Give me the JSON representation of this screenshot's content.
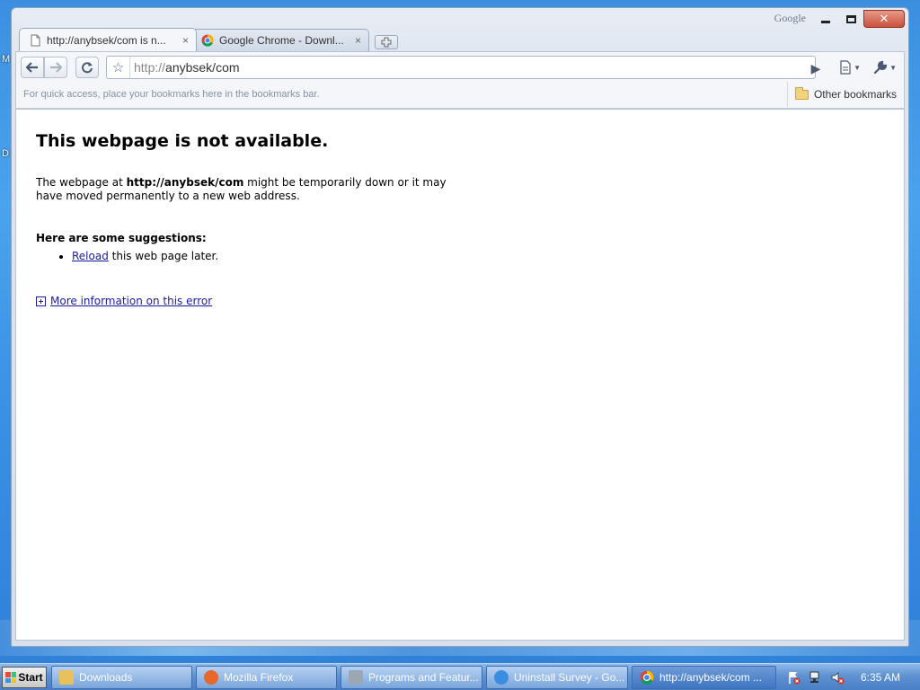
{
  "desktop": {
    "icon_letters": [
      "M",
      "D"
    ]
  },
  "window": {
    "brand_label": "Google",
    "controls": {
      "minimize": "minimize",
      "maximize": "maximize",
      "close": "✕"
    }
  },
  "tabs": [
    {
      "title": "http://anybsek/com is n...",
      "close": "×",
      "active": true,
      "icon": "page-icon"
    },
    {
      "title": "Google Chrome - Downl...",
      "close": "×",
      "active": false,
      "icon": "chrome-icon"
    }
  ],
  "toolbar": {
    "back": "back-arrow-icon",
    "forward": "forward-arrow-icon",
    "reload": "reload-icon",
    "url_scheme": "http://",
    "url_host": "anybsek/com",
    "go": "▶"
  },
  "bookmarks": {
    "hint": "For quick access, place your bookmarks here in the bookmarks bar.",
    "other": "Other bookmarks"
  },
  "error_page": {
    "heading": "This webpage is not available.",
    "desc_prefix": "The webpage at ",
    "desc_url": "http://anybsek/com",
    "desc_suffix": " might be temporarily down or it may have moved permanently to a new web address.",
    "suggestions_heading": "Here are some suggestions:",
    "reload_link": "Reload",
    "reload_suffix": " this web page later.",
    "more_info": "More information on this error"
  },
  "taskbar": {
    "start": "Start",
    "items": [
      {
        "label": "Downloads",
        "icon": "folder-icon",
        "color": "#e9c15a"
      },
      {
        "label": "Mozilla Firefox",
        "icon": "firefox-icon",
        "color": "#e8672a"
      },
      {
        "label": "Programs and Featur...",
        "icon": "programs-icon",
        "color": "#9aa8b6"
      },
      {
        "label": "Uninstall Survey - Go...",
        "icon": "ie-icon",
        "color": "#3a8ee0"
      },
      {
        "label": "http://anybsek/com ...",
        "icon": "chrome-icon",
        "color": "#e0463c",
        "active": true
      }
    ],
    "clock": "6:35 AM"
  }
}
